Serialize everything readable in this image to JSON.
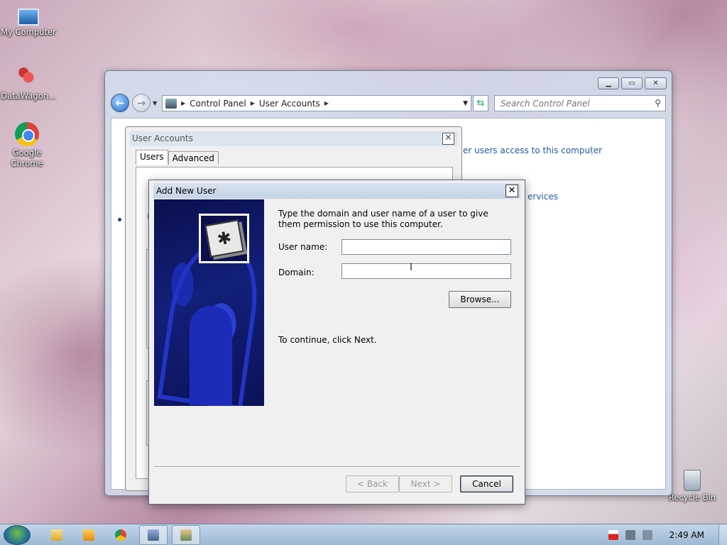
{
  "desktop": {
    "icons": [
      {
        "label": "My Computer",
        "icon": "computer-icon"
      },
      {
        "label": "DataWagon...",
        "icon": "datawagon-icon"
      },
      {
        "label": "Google Chrome",
        "icon": "chrome-icon"
      },
      {
        "label": "Recycle Bin",
        "icon": "recycle-bin-icon"
      }
    ]
  },
  "control_panel": {
    "breadcrumb": [
      "Control Panel",
      "User Accounts"
    ],
    "search_placeholder": "Search Control Panel",
    "links": [
      "er users access to this computer",
      "ervices"
    ]
  },
  "user_accounts": {
    "title": "User Accounts",
    "tabs": [
      "Users",
      "Advanced"
    ],
    "active_tab": "Users"
  },
  "add_new_user": {
    "title": "Add New User",
    "instructions": "Type the domain and user name of a user to give them permission to use this computer.",
    "username_label": "User name:",
    "username_value": "",
    "domain_label": "Domain:",
    "domain_value": "",
    "browse_label": "Browse...",
    "continue_text": "To continue, click Next.",
    "back_label": "< Back",
    "next_label": "Next >",
    "cancel_label": "Cancel"
  },
  "taskbar": {
    "clock": "2:49 AM",
    "pinned": [
      "explorer-icon",
      "media-player-icon",
      "chrome-icon",
      "control-panel-icon",
      "user-accounts-icon"
    ]
  }
}
